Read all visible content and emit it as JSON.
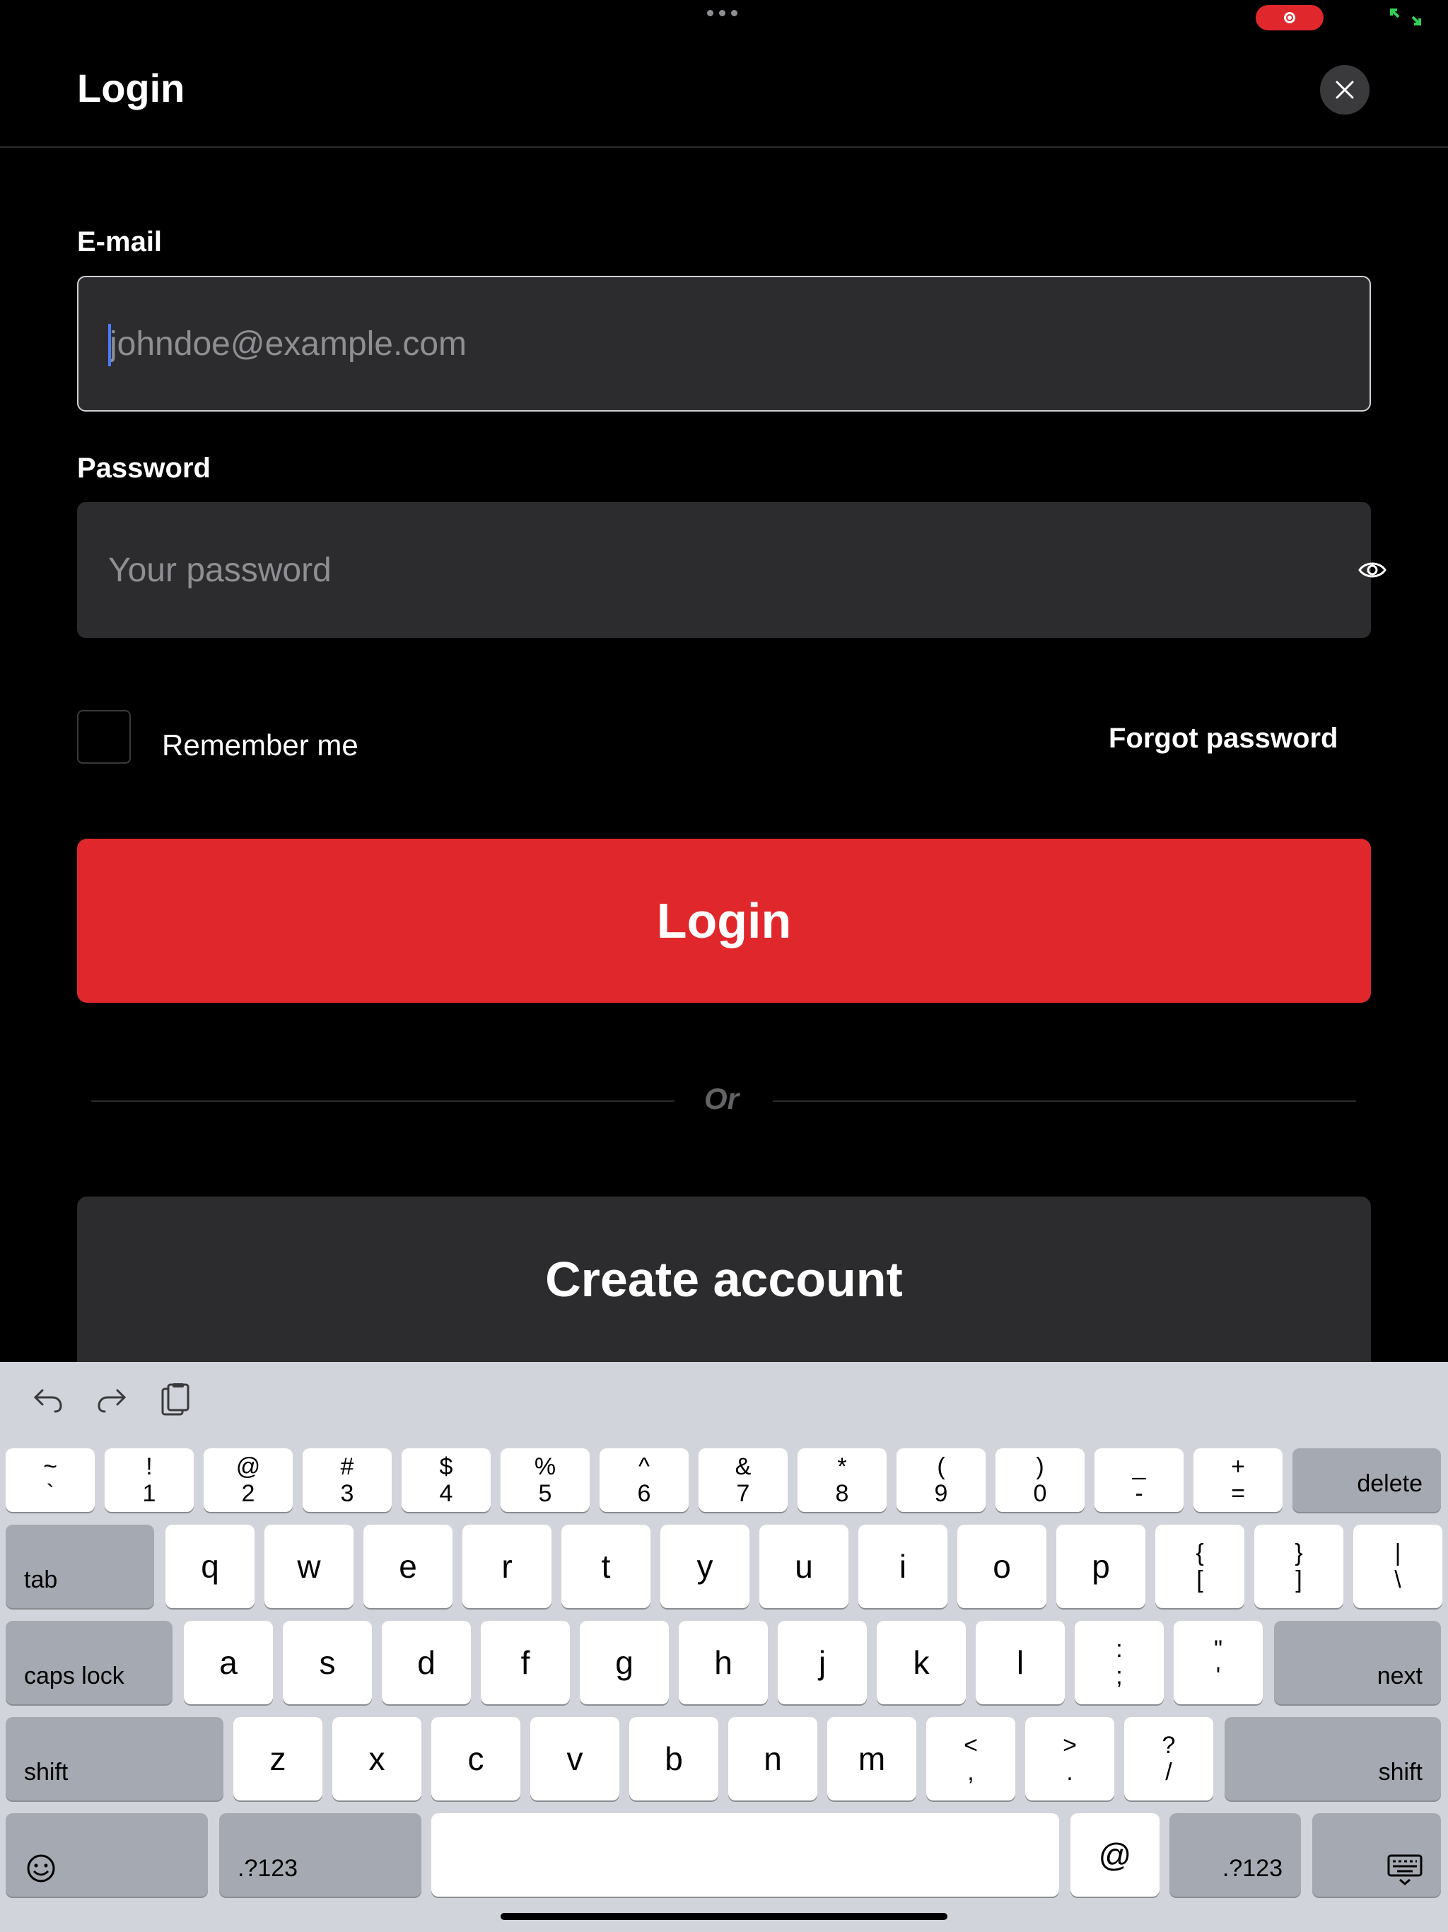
{
  "header": {
    "title": "Login"
  },
  "form": {
    "email_label": "E-mail",
    "email_placeholder": "johndoe@example.com",
    "password_label": "Password",
    "password_placeholder": "Your password",
    "remember_label": "Remember me",
    "forgot_label": "Forgot password",
    "login_label": "Login",
    "divider_label": "Or",
    "create_label": "Create account"
  },
  "colors": {
    "accent": "#e0282c",
    "field_bg": "#2c2c2e",
    "background": "#000000",
    "keyboard_bg": "#d1d4da"
  },
  "keyboard": {
    "number_row": [
      {
        "top": "~",
        "bottom": "`"
      },
      {
        "top": "!",
        "bottom": "1"
      },
      {
        "top": "@",
        "bottom": "2"
      },
      {
        "top": "#",
        "bottom": "3"
      },
      {
        "top": "$",
        "bottom": "4"
      },
      {
        "top": "%",
        "bottom": "5"
      },
      {
        "top": "^",
        "bottom": "6"
      },
      {
        "top": "&",
        "bottom": "7"
      },
      {
        "top": "*",
        "bottom": "8"
      },
      {
        "top": "(",
        "bottom": "9"
      },
      {
        "top": ")",
        "bottom": "0"
      },
      {
        "top": "_",
        "bottom": "-"
      },
      {
        "top": "+",
        "bottom": "="
      }
    ],
    "delete": "delete",
    "tab": "tab",
    "qwerty": [
      "q",
      "w",
      "e",
      "r",
      "t",
      "y",
      "u",
      "i",
      "o",
      "p"
    ],
    "brackets": [
      {
        "top": "{",
        "bottom": "["
      },
      {
        "top": "}",
        "bottom": "]"
      },
      {
        "top": "|",
        "bottom": "\\"
      }
    ],
    "caps_lock": "caps lock",
    "asdf": [
      "a",
      "s",
      "d",
      "f",
      "g",
      "h",
      "j",
      "k",
      "l"
    ],
    "semicolon": {
      "top": ":",
      "bottom": ";"
    },
    "quote": {
      "top": "\"",
      "bottom": "'"
    },
    "next": "next",
    "shift": "shift",
    "zxcv": [
      "z",
      "x",
      "c",
      "v",
      "b",
      "n",
      "m"
    ],
    "comma": {
      "top": "<",
      "bottom": ","
    },
    "period": {
      "top": ">",
      "bottom": "."
    },
    "slash": {
      "top": "?",
      "bottom": "/"
    },
    "numbers": ".?123",
    "at": "@"
  }
}
